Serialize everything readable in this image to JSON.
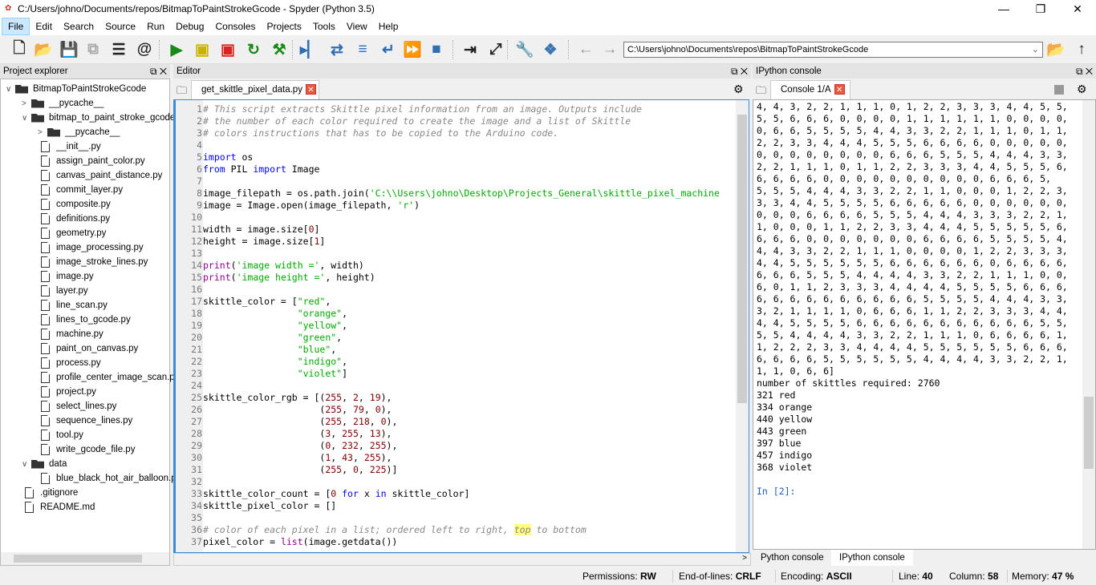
{
  "window": {
    "title": "C:/Users/johno/Documents/repos/BitmapToPaintStrokeGcode - Spyder (Python 3.5)",
    "minimize": "—",
    "maximize": "❐",
    "close": "✕"
  },
  "menu": [
    "File",
    "Edit",
    "Search",
    "Source",
    "Run",
    "Debug",
    "Consoles",
    "Projects",
    "Tools",
    "View",
    "Help"
  ],
  "toolbar": {
    "buttons": [
      {
        "name": "new-file-icon",
        "glyph": "🗋",
        "color": "#333"
      },
      {
        "name": "open-file-icon",
        "glyph": "📂",
        "color": "#333"
      },
      {
        "name": "save-icon",
        "glyph": "💾",
        "color": "#aaa"
      },
      {
        "name": "save-all-icon",
        "glyph": "⧉",
        "color": "#aaa"
      },
      {
        "name": "list-icon",
        "glyph": "☰",
        "color": "#222"
      },
      {
        "name": "at-icon",
        "glyph": "@",
        "color": "#222"
      },
      {
        "name": "run-icon",
        "glyph": "▶",
        "color": "#178a17"
      },
      {
        "name": "run-cell-icon",
        "glyph": "▣",
        "color": "#c8b400"
      },
      {
        "name": "run-cell-advance-icon",
        "glyph": "▣",
        "color": "#d22"
      },
      {
        "name": "rerun-icon",
        "glyph": "↻",
        "color": "#178a17"
      },
      {
        "name": "run-config-icon",
        "glyph": "⚒",
        "color": "#178a17"
      },
      {
        "name": "debug-icon",
        "glyph": "▸▏",
        "color": "#2f6db5"
      },
      {
        "name": "step-icon",
        "glyph": "⇄",
        "color": "#2f6db5"
      },
      {
        "name": "step-into-icon",
        "glyph": "≡",
        "color": "#2f6db5"
      },
      {
        "name": "step-return-icon",
        "glyph": "↵",
        "color": "#2f6db5"
      },
      {
        "name": "continue-icon",
        "glyph": "⏩",
        "color": "#2f6db5"
      },
      {
        "name": "stop-icon",
        "glyph": "■",
        "color": "#2f6db5"
      },
      {
        "name": "maximize-pane-icon",
        "glyph": "⇥",
        "color": "#222"
      },
      {
        "name": "fullscreen-icon",
        "glyph": "⤢",
        "color": "#222"
      },
      {
        "name": "preferences-icon",
        "glyph": "🔧",
        "color": "#222"
      },
      {
        "name": "python-path-icon",
        "glyph": "❖",
        "color": "#3a75b0"
      },
      {
        "name": "back-icon",
        "glyph": "←",
        "color": "#999"
      },
      {
        "name": "forward-icon",
        "glyph": "→",
        "color": "#999"
      }
    ],
    "working_dir": "C:\\Users\\johno\\Documents\\repos\\BitmapToPaintStrokeGcode",
    "browse_glyph": "📂",
    "up_glyph": "↑"
  },
  "explorer": {
    "title": "Project explorer",
    "items": [
      {
        "label": "BitmapToPaintStrokeGcode",
        "type": "folder",
        "depth": 0,
        "arrow": "∨"
      },
      {
        "label": "__pycache__",
        "type": "folder",
        "depth": 1,
        "arrow": ">"
      },
      {
        "label": "bitmap_to_paint_stroke_gcode",
        "type": "folder",
        "depth": 1,
        "arrow": "∨"
      },
      {
        "label": "__pycache__",
        "type": "folder",
        "depth": 2,
        "arrow": ">"
      },
      {
        "label": "__init__.py",
        "type": "file",
        "depth": 2
      },
      {
        "label": "assign_paint_color.py",
        "type": "file",
        "depth": 2
      },
      {
        "label": "canvas_paint_distance.py",
        "type": "file",
        "depth": 2
      },
      {
        "label": "commit_layer.py",
        "type": "file",
        "depth": 2
      },
      {
        "label": "composite.py",
        "type": "file",
        "depth": 2
      },
      {
        "label": "definitions.py",
        "type": "file",
        "depth": 2
      },
      {
        "label": "geometry.py",
        "type": "file",
        "depth": 2
      },
      {
        "label": "image_processing.py",
        "type": "file",
        "depth": 2
      },
      {
        "label": "image_stroke_lines.py",
        "type": "file",
        "depth": 2
      },
      {
        "label": "image.py",
        "type": "file",
        "depth": 2
      },
      {
        "label": "layer.py",
        "type": "file",
        "depth": 2
      },
      {
        "label": "line_scan.py",
        "type": "file",
        "depth": 2
      },
      {
        "label": "lines_to_gcode.py",
        "type": "file",
        "depth": 2
      },
      {
        "label": "machine.py",
        "type": "file",
        "depth": 2
      },
      {
        "label": "paint_on_canvas.py",
        "type": "file",
        "depth": 2
      },
      {
        "label": "process.py",
        "type": "file",
        "depth": 2
      },
      {
        "label": "profile_center_image_scan.py",
        "type": "file",
        "depth": 2
      },
      {
        "label": "project.py",
        "type": "file",
        "depth": 2
      },
      {
        "label": "select_lines.py",
        "type": "file",
        "depth": 2
      },
      {
        "label": "sequence_lines.py",
        "type": "file",
        "depth": 2
      },
      {
        "label": "tool.py",
        "type": "file",
        "depth": 2
      },
      {
        "label": "write_gcode_file.py",
        "type": "file",
        "depth": 2
      },
      {
        "label": "data",
        "type": "folder",
        "depth": 1,
        "arrow": "∨"
      },
      {
        "label": "blue_black_hot_air_balloon.png",
        "type": "file",
        "depth": 2
      },
      {
        "label": ".gitignore",
        "type": "file",
        "depth": 1
      },
      {
        "label": "README.md",
        "type": "file",
        "depth": 1
      }
    ]
  },
  "editor": {
    "title": "Editor",
    "tab": "get_skittle_pixel_data.py",
    "lines": [
      [
        [
          "# This script extracts Skittle pixel information from an image. Outputs include",
          "c"
        ]
      ],
      [
        [
          "# the number of each color required to create the image and a list of Skittle",
          "c"
        ]
      ],
      [
        [
          "# colors instructions that has to be copied to the Arduino code.",
          "c"
        ]
      ],
      [],
      [
        [
          "import",
          "k"
        ],
        [
          " os",
          "p"
        ]
      ],
      [
        [
          "from",
          "k"
        ],
        [
          " PIL ",
          "p"
        ],
        [
          "import",
          "k"
        ],
        [
          " Image",
          "p"
        ]
      ],
      [],
      [
        [
          "image_filepath = os.path.join(",
          "p"
        ],
        [
          "'C:\\\\Users\\johno\\Desktop\\Projects_General\\skittle_pixel_machine",
          "s"
        ]
      ],
      [
        [
          "image = Image.open(image_filepath, ",
          "p"
        ],
        [
          "'r'",
          "s"
        ],
        [
          ")",
          "p"
        ]
      ],
      [],
      [
        [
          "width = image.size[",
          "p"
        ],
        [
          "0",
          "n"
        ],
        [
          "]",
          "p"
        ]
      ],
      [
        [
          "height = image.size[",
          "p"
        ],
        [
          "1",
          "n"
        ],
        [
          "]",
          "p"
        ]
      ],
      [],
      [
        [
          "print",
          "b"
        ],
        [
          "(",
          "p"
        ],
        [
          "'image width ='",
          "s"
        ],
        [
          ", width)",
          "p"
        ]
      ],
      [
        [
          "print",
          "b"
        ],
        [
          "(",
          "p"
        ],
        [
          "'image height ='",
          "s"
        ],
        [
          ", height)",
          "p"
        ]
      ],
      [],
      [
        [
          "skittle_color = [",
          "p"
        ],
        [
          "\"red\"",
          "s"
        ],
        [
          ",",
          "p"
        ]
      ],
      [
        [
          "                 ",
          "p"
        ],
        [
          "\"orange\"",
          "s"
        ],
        [
          ",",
          "p"
        ]
      ],
      [
        [
          "                 ",
          "p"
        ],
        [
          "\"yellow\"",
          "s"
        ],
        [
          ",",
          "p"
        ]
      ],
      [
        [
          "                 ",
          "p"
        ],
        [
          "\"green\"",
          "s"
        ],
        [
          ",",
          "p"
        ]
      ],
      [
        [
          "                 ",
          "p"
        ],
        [
          "\"blue\"",
          "s"
        ],
        [
          ",",
          "p"
        ]
      ],
      [
        [
          "                 ",
          "p"
        ],
        [
          "\"indigo\"",
          "s"
        ],
        [
          ",",
          "p"
        ]
      ],
      [
        [
          "                 ",
          "p"
        ],
        [
          "\"violet\"",
          "s"
        ],
        [
          "]",
          "p"
        ]
      ],
      [],
      [
        [
          "skittle_color_rgb = [(",
          "p"
        ],
        [
          "255",
          "n"
        ],
        [
          ", ",
          "p"
        ],
        [
          "2",
          "n"
        ],
        [
          ", ",
          "p"
        ],
        [
          "19",
          "n"
        ],
        [
          "),",
          "p"
        ]
      ],
      [
        [
          "                     (",
          "p"
        ],
        [
          "255",
          "n"
        ],
        [
          ", ",
          "p"
        ],
        [
          "79",
          "n"
        ],
        [
          ", ",
          "p"
        ],
        [
          "0",
          "n"
        ],
        [
          "),",
          "p"
        ]
      ],
      [
        [
          "                     (",
          "p"
        ],
        [
          "255",
          "n"
        ],
        [
          ", ",
          "p"
        ],
        [
          "218",
          "n"
        ],
        [
          ", ",
          "p"
        ],
        [
          "0",
          "n"
        ],
        [
          "),",
          "p"
        ]
      ],
      [
        [
          "                     (",
          "p"
        ],
        [
          "3",
          "n"
        ],
        [
          ", ",
          "p"
        ],
        [
          "255",
          "n"
        ],
        [
          ", ",
          "p"
        ],
        [
          "13",
          "n"
        ],
        [
          "),",
          "p"
        ]
      ],
      [
        [
          "                     (",
          "p"
        ],
        [
          "0",
          "n"
        ],
        [
          ", ",
          "p"
        ],
        [
          "232",
          "n"
        ],
        [
          ", ",
          "p"
        ],
        [
          "255",
          "n"
        ],
        [
          "),",
          "p"
        ]
      ],
      [
        [
          "                     (",
          "p"
        ],
        [
          "1",
          "n"
        ],
        [
          ", ",
          "p"
        ],
        [
          "43",
          "n"
        ],
        [
          ", ",
          "p"
        ],
        [
          "255",
          "n"
        ],
        [
          "),",
          "p"
        ]
      ],
      [
        [
          "                     (",
          "p"
        ],
        [
          "255",
          "n"
        ],
        [
          ", ",
          "p"
        ],
        [
          "0",
          "n"
        ],
        [
          ", ",
          "p"
        ],
        [
          "225",
          "n"
        ],
        [
          ")]",
          "p"
        ]
      ],
      [],
      [
        [
          "skittle_color_count = [",
          "p"
        ],
        [
          "0",
          "n"
        ],
        [
          " ",
          "p"
        ],
        [
          "for",
          "k"
        ],
        [
          " x ",
          "p"
        ],
        [
          "in",
          "k"
        ],
        [
          " skittle_color]",
          "p"
        ]
      ],
      [
        [
          "skittle_pixel_color = []",
          "p"
        ]
      ],
      [],
      [
        [
          "# color of each pixel in a list; ordered left to right, ",
          "c"
        ],
        [
          "top",
          "h"
        ],
        [
          " to bottom",
          "c"
        ]
      ],
      [
        [
          "pixel_color = ",
          "p"
        ],
        [
          "list",
          "b"
        ],
        [
          "(image.getdata())",
          "p"
        ]
      ]
    ]
  },
  "console": {
    "title": "IPython console",
    "tab": "Console 1/A",
    "output": [
      "4, 4, 3, 2, 2, 1, 1, 1, 0, 1, 2, 2, 3, 3, 3, 4, 4, 5, 5,",
      "5, 5, 6, 6, 6, 0, 0, 0, 0, 1, 1, 1, 1, 1, 1, 0, 0, 0, 0,",
      "0, 6, 6, 5, 5, 5, 5, 4, 4, 3, 3, 2, 2, 1, 1, 1, 0, 1, 1,",
      "2, 2, 3, 3, 4, 4, 4, 5, 5, 5, 6, 6, 6, 6, 0, 0, 0, 0, 0,",
      "0, 0, 0, 0, 0, 0, 0, 0, 6, 6, 6, 5, 5, 5, 4, 4, 4, 3, 3,",
      "2, 2, 1, 1, 1, 0, 1, 1, 2, 2, 3, 3, 3, 4, 4, 5, 5, 5, 6,",
      "6, 6, 6, 6, 0, 0, 0, 0, 0, 0, 0, 0, 0, 0, 6, 6, 6, 5,",
      "5, 5, 5, 4, 4, 4, 3, 3, 2, 2, 1, 1, 0, 0, 0, 1, 2, 2, 3,",
      "3, 3, 4, 4, 5, 5, 5, 5, 6, 6, 6, 6, 6, 0, 0, 0, 0, 0, 0,",
      "0, 0, 0, 6, 6, 6, 6, 5, 5, 5, 4, 4, 4, 3, 3, 3, 2, 2, 1,",
      "1, 0, 0, 0, 1, 1, 2, 2, 3, 3, 4, 4, 4, 5, 5, 5, 5, 5, 6,",
      "6, 6, 6, 0, 0, 0, 0, 0, 0, 0, 6, 6, 6, 6, 5, 5, 5, 5, 4,",
      "4, 4, 3, 3, 2, 2, 1, 1, 1, 0, 0, 0, 0, 1, 2, 2, 3, 3, 3,",
      "4, 4, 5, 5, 5, 5, 5, 5, 6, 6, 6, 6, 6, 6, 0, 6, 6, 6, 6,",
      "6, 6, 6, 5, 5, 5, 4, 4, 4, 4, 3, 3, 2, 2, 1, 1, 1, 0, 0,",
      "6, 0, 1, 1, 2, 3, 3, 3, 4, 4, 4, 4, 5, 5, 5, 5, 6, 6, 6,",
      "6, 6, 6, 6, 6, 6, 6, 6, 6, 6, 5, 5, 5, 5, 4, 4, 4, 3, 3,",
      "3, 2, 1, 1, 1, 1, 0, 6, 6, 6, 1, 1, 2, 2, 3, 3, 3, 4, 4,",
      "4, 4, 5, 5, 5, 5, 6, 6, 6, 6, 6, 6, 6, 6, 6, 6, 6, 5, 5,",
      "5, 5, 4, 4, 4, 4, 3, 3, 2, 2, 1, 1, 1, 0, 6, 6, 6, 6, 1,",
      "1, 2, 2, 2, 3, 3, 4, 4, 4, 4, 5, 5, 5, 5, 5, 5, 6, 6, 6,",
      "6, 6, 6, 6, 5, 5, 5, 5, 5, 5, 4, 4, 4, 4, 3, 3, 2, 2, 1,",
      "1, 1, 0, 6, 6]",
      "number of skittles required: 2760",
      "321 red",
      "334 orange",
      "440 yellow",
      "443 green",
      "397 blue",
      "457 indigo",
      "368 violet",
      "",
      "In [2]:"
    ],
    "bottom_tabs": [
      "Python console",
      "IPython console"
    ]
  },
  "status": {
    "permissions_label": "Permissions:",
    "permissions": "RW",
    "eol_label": "End-of-lines:",
    "eol": "CRLF",
    "encoding_label": "Encoding:",
    "encoding": "ASCII",
    "line_label": "Line:",
    "line": "40",
    "column_label": "Column:",
    "column": "58",
    "memory_label": "Memory:",
    "memory": "47 %"
  }
}
